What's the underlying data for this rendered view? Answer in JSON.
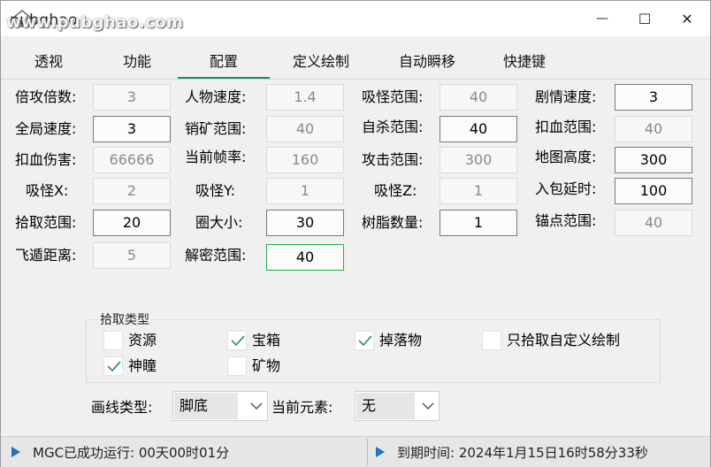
{
  "window": {
    "title": "pubghao",
    "watermark": "www.pubghao.com",
    "minimize_label": "—",
    "maximize_label": "☐",
    "close_label": "✕"
  },
  "tabs": [
    "透视",
    "功能",
    "配置",
    "定义绘制",
    "自动瞬移",
    "快捷键"
  ],
  "active_tab": "配置",
  "settings": {
    "col1": [
      {
        "label": "倍攻倍数:",
        "value": "3"
      },
      {
        "label": "全局速度:",
        "value": "3"
      },
      {
        "label": "扣血伤害:",
        "value": "66666"
      },
      {
        "label": "吸怪X:",
        "value": "2"
      },
      {
        "label": "拾取范围:",
        "value": "20"
      },
      {
        "label": "飞遁距离:",
        "value": "5"
      }
    ],
    "col2": [
      {
        "label": "人物速度:",
        "value": "1.4"
      },
      {
        "label": "销矿范围:",
        "value": "40"
      },
      {
        "label": "当前帧率:",
        "value": "160"
      },
      {
        "label": "吸怪Y:",
        "value": "1"
      },
      {
        "label": "圈大小:",
        "value": "30"
      },
      {
        "label": "解密范围:",
        "value": "40"
      }
    ],
    "col3": [
      {
        "label": "吸怪范围:",
        "value": "40"
      },
      {
        "label": "自杀范围:",
        "value": "40"
      },
      {
        "label": "攻击范围:",
        "value": "300"
      },
      {
        "label": "吸怪Z:",
        "value": "1"
      },
      {
        "label": "树脂数量:",
        "value": "1"
      }
    ],
    "col4": [
      {
        "label": "剧情速度:",
        "value": "3"
      },
      {
        "label": "扣血范围:",
        "value": "40"
      },
      {
        "label": "地图高度:",
        "value": "300"
      },
      {
        "label": "入包延时:",
        "value": "100"
      },
      {
        "label": "锚点范围:",
        "value": "40"
      }
    ]
  },
  "pickup": {
    "title": "拾取类型",
    "items": [
      {
        "label": "资源",
        "checked": false
      },
      {
        "label": "宝箱",
        "checked": true
      },
      {
        "label": "掉落物",
        "checked": true
      },
      {
        "label": "只拾取自定义绘制",
        "checked": false
      },
      {
        "label": "神瞳",
        "checked": true
      },
      {
        "label": "矿物",
        "checked": false
      }
    ]
  },
  "line_type": {
    "label": "画线类型:",
    "value": "脚底"
  },
  "current_element": {
    "label": "当前元素:",
    "value": "无"
  },
  "status": {
    "left": "MGC已成功运行: 00天00时01分",
    "right": "到期时间: 2024年1月15日16时58分33秒"
  },
  "colors": {
    "accent": "#1b8a5a",
    "focus": "#22b14c",
    "status_icon": "#1e73be"
  }
}
